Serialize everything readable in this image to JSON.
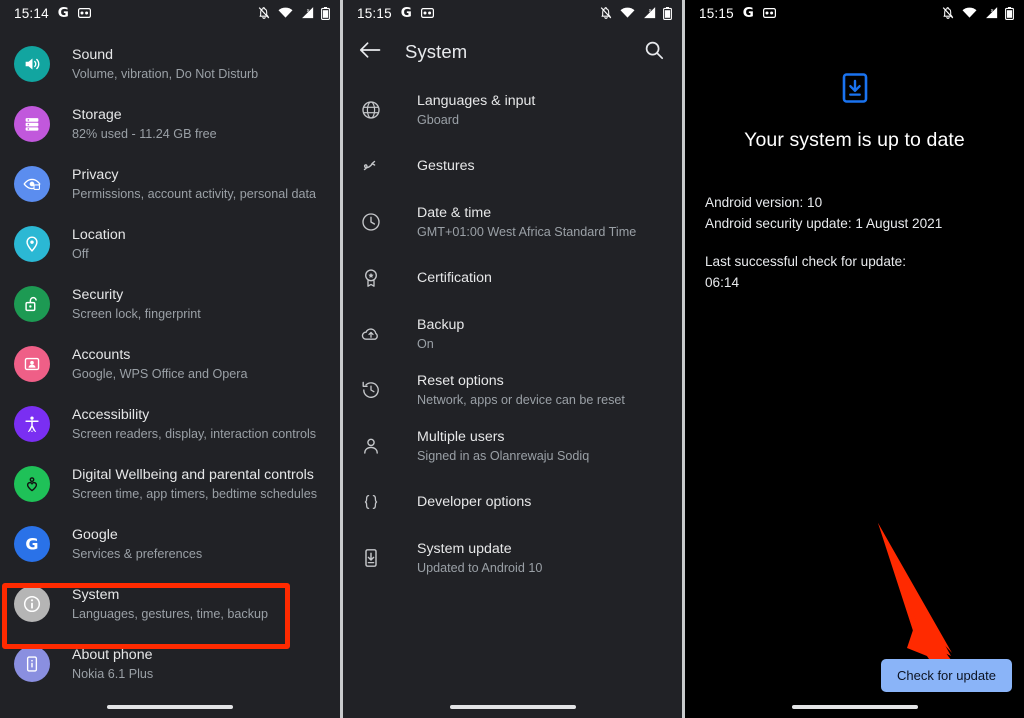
{
  "settings_panel": {
    "status_bar": {
      "time": "15:14",
      "google_glyph": "G",
      "icons": [
        "notifications-off-icon",
        "wifi-icon",
        "cellular-signal-icon",
        "battery-icon"
      ]
    },
    "items": [
      {
        "title": "Sound",
        "sub": "Volume, vibration, Do Not Disturb",
        "icon": "sound-icon",
        "color": "#12a5a0"
      },
      {
        "title": "Storage",
        "sub": "82% used - 11.24 GB free",
        "icon": "storage-icon",
        "color": "#c158dc"
      },
      {
        "title": "Privacy",
        "sub": "Permissions, account activity, personal data",
        "icon": "privacy-icon",
        "color": "#5b8def"
      },
      {
        "title": "Location",
        "sub": "Off",
        "icon": "location-icon",
        "color": "#2bb8d4"
      },
      {
        "title": "Security",
        "sub": "Screen lock, fingerprint",
        "icon": "security-icon",
        "color": "#1d9a53"
      },
      {
        "title": "Accounts",
        "sub": "Google, WPS Office and Opera",
        "icon": "accounts-icon",
        "color": "#ef5f87"
      },
      {
        "title": "Accessibility",
        "sub": "Screen readers, display, interaction controls",
        "icon": "accessibility-icon",
        "color": "#7a2ff2"
      },
      {
        "title": "Digital Wellbeing and parental controls",
        "sub": "Screen time, app timers, bedtime schedules",
        "icon": "wellbeing-icon",
        "color": "#1fc158"
      },
      {
        "title": "Google",
        "sub": "Services & preferences",
        "icon": "google-icon",
        "color": "#2a72e8"
      },
      {
        "title": "System",
        "sub": "Languages, gestures, time, backup",
        "icon": "system-info-icon",
        "color": "#b5b5b5"
      },
      {
        "title": "About phone",
        "sub": "Nokia 6.1 Plus",
        "icon": "phone-icon",
        "color": "#8a8fe0"
      }
    ],
    "highlight": {
      "target": "System",
      "color": "#ff2a00"
    }
  },
  "system_panel": {
    "status_bar": {
      "time": "15:15",
      "google_glyph": "G",
      "icons": [
        "notifications-off-icon",
        "wifi-icon",
        "cellular-signal-icon",
        "battery-icon"
      ]
    },
    "appbar": {
      "back_label": "back-arrow",
      "title": "System",
      "search_label": "search"
    },
    "items": [
      {
        "title": "Languages & input",
        "sub": "Gboard",
        "icon": "globe-icon"
      },
      {
        "title": "Gestures",
        "sub": "",
        "icon": "gesture-icon"
      },
      {
        "title": "Date & time",
        "sub": "GMT+01:00 West Africa Standard Time",
        "icon": "clock-icon"
      },
      {
        "title": "Certification",
        "sub": "",
        "icon": "certification-icon"
      },
      {
        "title": "Backup",
        "sub": "On",
        "icon": "cloud-upload-icon"
      },
      {
        "title": "Reset options",
        "sub": "Network, apps or device can be reset",
        "icon": "history-icon"
      },
      {
        "title": "Multiple users",
        "sub": "Signed in as Olanrewaju Sodiq",
        "icon": "person-icon"
      },
      {
        "title": "Developer options",
        "sub": "",
        "icon": "braces-icon"
      },
      {
        "title": "System update",
        "sub": "Updated to Android 10",
        "icon": "system-update-icon"
      }
    ],
    "highlight": {
      "target": "System update",
      "color": "#ff2a00"
    }
  },
  "update_panel": {
    "status_bar": {
      "time": "15:15",
      "google_glyph": "G",
      "icons": [
        "notifications-off-icon",
        "wifi-icon",
        "cellular-signal-icon",
        "battery-icon"
      ]
    },
    "hero_icon": "system-update-icon",
    "hero_icon_color": "#1a73f0",
    "heading": "Your system is up to date",
    "android_version": "Android version: 10",
    "security_update": "Android security update: 1 August 2021",
    "last_check_label": "Last successful check for update:",
    "last_check_time": "06:14",
    "check_button": "Check for update",
    "check_button_color": "#8ab4f8",
    "annotation_arrow": {
      "name": "red-pointer-arrow",
      "color": "#ff2a00",
      "points_to": "Check for update"
    }
  }
}
